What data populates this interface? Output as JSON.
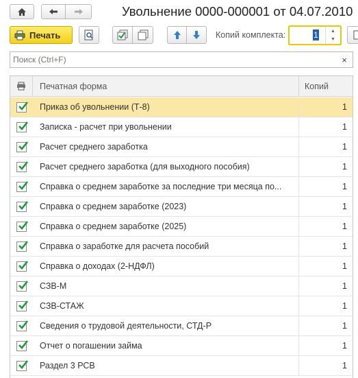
{
  "header": {
    "title": "Увольнение 0000-000001 от 04.07.2010"
  },
  "toolbar": {
    "print_label": "Печать",
    "copies_label": "Копий комплекта:",
    "copies_value": "1"
  },
  "search": {
    "placeholder": "Поиск (Ctrl+F)",
    "clear_symbol": "×"
  },
  "table": {
    "columns": {
      "form": "Печатная форма",
      "copies": "Копий"
    },
    "rows": [
      {
        "name": "Приказ об увольнении (Т-8)",
        "copies": "1",
        "checked": true,
        "selected": true
      },
      {
        "name": "Записка - расчет при увольнении",
        "copies": "1",
        "checked": true
      },
      {
        "name": "Расчет среднего заработка",
        "copies": "1",
        "checked": true
      },
      {
        "name": "Расчет среднего заработка (для выходного пособия)",
        "copies": "1",
        "checked": true
      },
      {
        "name": "Справка о среднем заработке за последние три месяца по...",
        "copies": "1",
        "checked": true
      },
      {
        "name": "Справка о среднем заработке (2023)",
        "copies": "1",
        "checked": true
      },
      {
        "name": "Справка о среднем заработке (2025)",
        "copies": "1",
        "checked": true
      },
      {
        "name": "Справка о заработке для расчета пособий",
        "copies": "1",
        "checked": true
      },
      {
        "name": "Справка о доходах (2-НДФЛ)",
        "copies": "1",
        "checked": true
      },
      {
        "name": "СЗВ-М",
        "copies": "1",
        "checked": true
      },
      {
        "name": "СЗВ-СТАЖ",
        "copies": "1",
        "checked": true
      },
      {
        "name": "Сведения о трудовой деятельности, СТД-Р",
        "copies": "1",
        "checked": true
      },
      {
        "name": "Отчет о погашении займа",
        "copies": "1",
        "checked": true
      },
      {
        "name": "Раздел 3 РСВ",
        "copies": "1",
        "checked": true
      }
    ]
  },
  "colors": {
    "accent_yellow": "#f2d21c",
    "selected_row": "#fbe7a6",
    "check_green": "#1e9a3c",
    "arrow_blue": "#2f7fd6"
  },
  "icons": {
    "home": "home-icon",
    "back": "arrow-left-icon",
    "forward": "arrow-right-icon",
    "printer": "printer-icon",
    "preview": "preview-icon",
    "check_all": "check-all-icon",
    "uncheck_all": "uncheck-all-icon",
    "move_up": "arrow-up-icon",
    "move_down": "arrow-down-icon",
    "settings": "settings-icon"
  }
}
